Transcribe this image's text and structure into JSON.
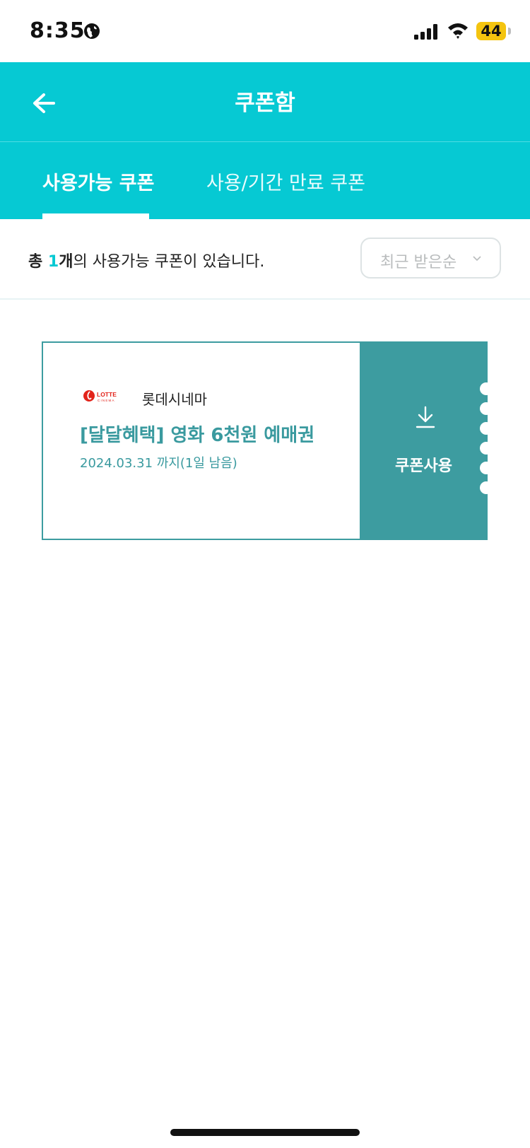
{
  "status_bar": {
    "time": "8:35",
    "battery": "44"
  },
  "header": {
    "title": "쿠폰함"
  },
  "tabs": [
    {
      "label": "사용가능 쿠폰",
      "active": true
    },
    {
      "label": "사용/기간 만료 쿠폰",
      "active": false
    }
  ],
  "summary": {
    "prefix": "총 ",
    "count": "1",
    "unit": "개",
    "suffix": "의 사용가능 쿠폰이 있습니다."
  },
  "sort": {
    "selected": "최근 받은순"
  },
  "coupons": [
    {
      "brand_logo": "LOTTE CINEMA",
      "brand_name": "롯데시네마",
      "title": "[달달혜택] 영화 6천원 예매권",
      "expiry": "2024.03.31 까지(1일 남음)",
      "action_label": "쿠폰사용"
    }
  ],
  "colors": {
    "accent": "#06c9d3",
    "coupon_teal": "#3d9ca0",
    "battery": "#f4c40f"
  },
  "icons": [
    "globe-icon",
    "cellular-signal-icon",
    "wifi-icon",
    "battery-icon",
    "back-arrow-icon",
    "chevron-down-icon",
    "download-icon",
    "lotte-cinema-logo"
  ]
}
